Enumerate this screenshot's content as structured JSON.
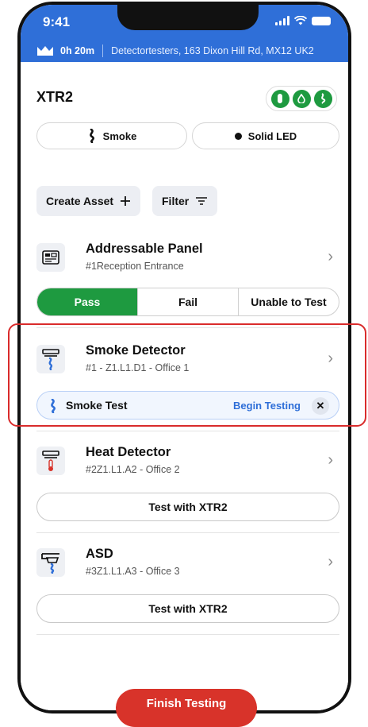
{
  "status_bar": {
    "time": "9:41"
  },
  "info_bar": {
    "duration": "0h 20m",
    "location": "Detectortesters, 163 Dixon Hill Rd, MX12 UK2"
  },
  "device": {
    "name": "XTR2",
    "pills": [
      {
        "label": "Smoke",
        "icon": "smoke-icon"
      },
      {
        "label": "Solid LED",
        "icon": "led-dot-icon"
      }
    ]
  },
  "actions": {
    "create_label": "Create Asset",
    "filter_label": "Filter"
  },
  "assets": [
    {
      "title": "Addressable Panel",
      "subtitle": "#1Reception Entrance",
      "icon": "panel-icon",
      "segments": [
        "Pass",
        "Fail",
        "Unable to Test"
      ],
      "selected": "Pass"
    },
    {
      "title": "Smoke Detector",
      "subtitle": "#1 - Z1.L1.D1 - Office 1",
      "icon": "smoke-detector-icon",
      "test_label": "Smoke Test",
      "begin_label": "Begin Testing",
      "close_label": "✕"
    },
    {
      "title": "Heat Detector",
      "subtitle": "#2Z1.L1.A2 - Office 2",
      "icon": "heat-detector-icon",
      "button_label": "Test with XTR2"
    },
    {
      "title": "ASD",
      "subtitle": "#3Z1.L1.A3 - Office 3",
      "icon": "asd-icon",
      "button_label": "Test with XTR2"
    }
  ],
  "chevron": "›",
  "finish_label": "Finish Testing",
  "colors": {
    "brand_blue": "#2f6fd8",
    "pass_green": "#1e9a40",
    "finish_red": "#d8332a",
    "highlight_red": "#d92b2b"
  }
}
